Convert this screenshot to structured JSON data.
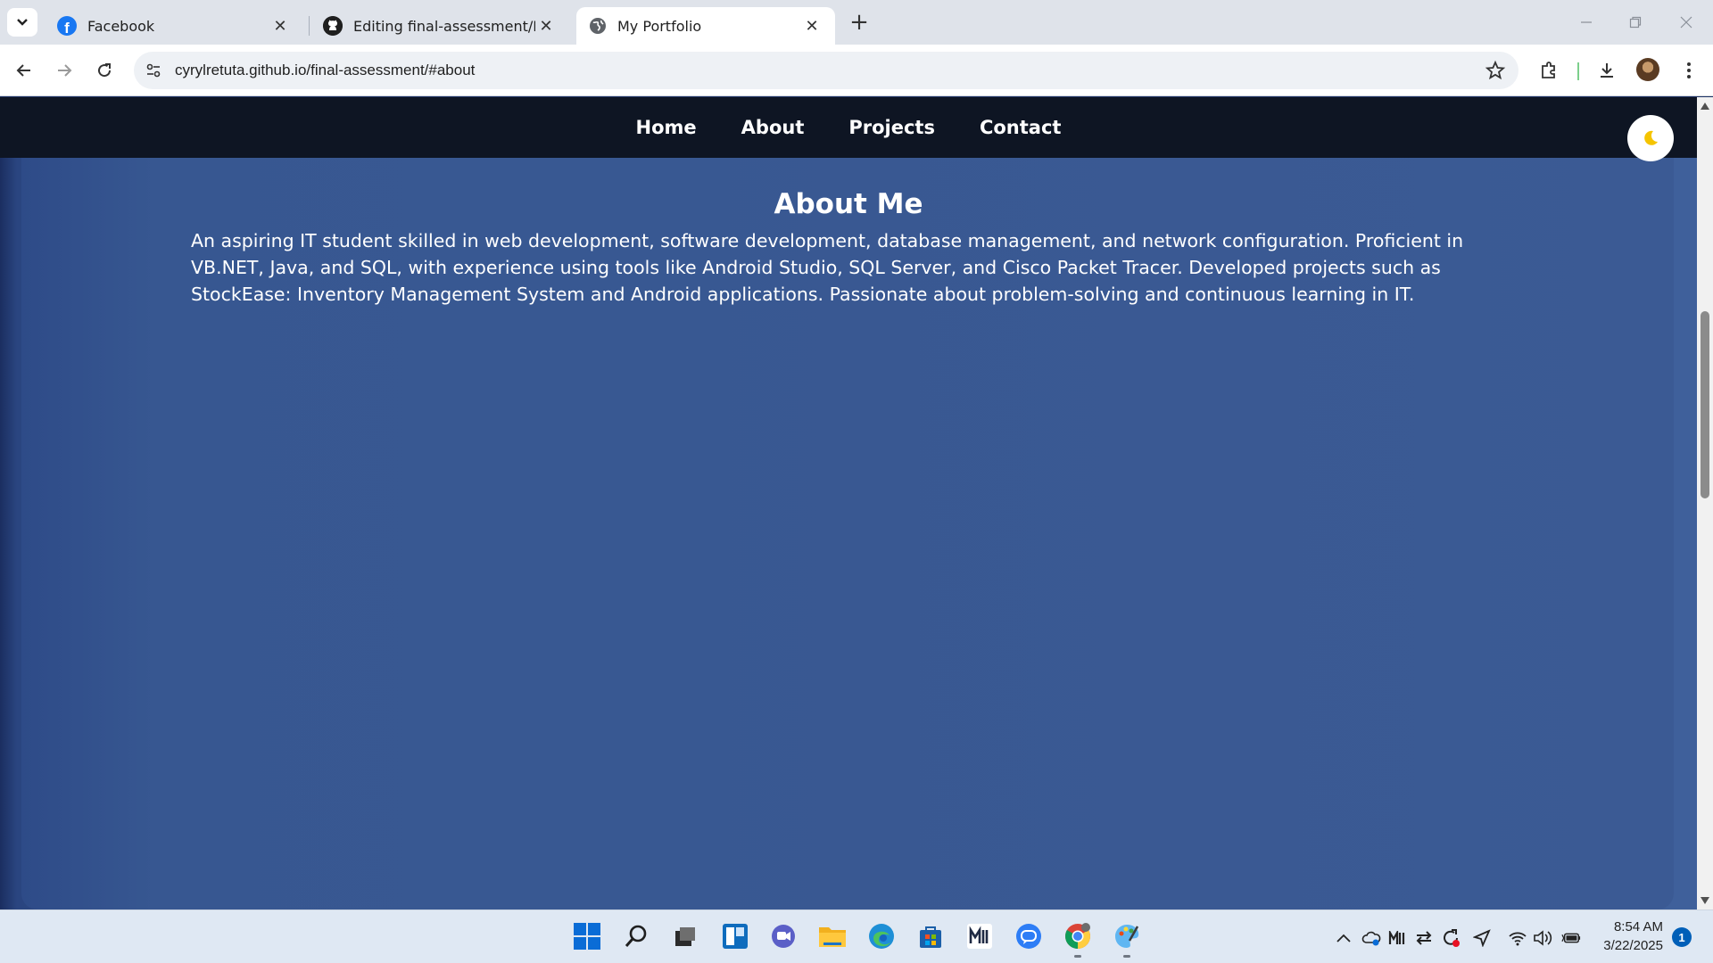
{
  "browser": {
    "tabs": [
      {
        "title": "Facebook",
        "icon": "facebook-icon",
        "active": false
      },
      {
        "title": "Editing final-assessment/READ",
        "icon": "github-icon",
        "active": false
      },
      {
        "title": "My Portfolio",
        "icon": "globe-icon",
        "active": true
      }
    ],
    "close_glyph": "✕",
    "new_tab_glyph": "+",
    "address": "cyrylretuta.github.io/final-assessment/#about"
  },
  "page": {
    "nav": [
      "Home",
      "About",
      "Projects",
      "Contact"
    ],
    "theme_toggle_glyph": "🌙",
    "about_title": "About Me",
    "about_text": "An aspiring IT student skilled in web development, software development, database management, and network configuration. Proficient in VB.NET, Java, and SQL, with experience using tools like Android Studio, SQL Server, and Cisco Packet Tracer. Developed projects such as StockEase: Inventory Management System and Android applications. Passionate about problem-solving and continuous learning in IT."
  },
  "taskbar": {
    "apps": [
      "start",
      "search",
      "task-view",
      "widgets",
      "teams",
      "file-explorer",
      "edge",
      "store",
      "app",
      "messenger",
      "chrome",
      "paint"
    ],
    "time": "8:54 AM",
    "date": "3/22/2025",
    "notifications": "1"
  },
  "colors": {
    "nav_bg": "#0e1523",
    "section_bg": "#3b5a94",
    "accent_moon": "#f5c400"
  }
}
